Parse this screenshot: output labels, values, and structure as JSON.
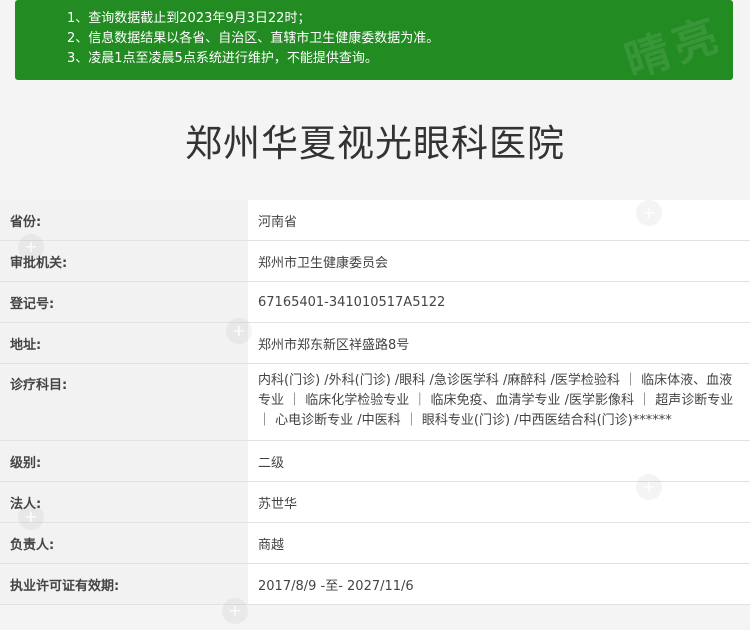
{
  "notice": {
    "lines": [
      "1、查询数据截止到2023年9月3日22时；",
      "2、信息数据结果以各省、自治区、直辖市卫生健康委数据为准。",
      "3、凌晨1点至凌晨5点系统进行维护，不能提供查询。"
    ],
    "watermark": "晴亮",
    "colors": {
      "background": "#228b22",
      "text": "#ffffff"
    }
  },
  "page_title": "郑州华夏视光眼科医院",
  "rows": [
    {
      "label": "省份:",
      "value": "河南省"
    },
    {
      "label": "审批机关:",
      "value": "郑州市卫生健康委员会"
    },
    {
      "label": "登记号:",
      "value": "67165401-341010517A5122"
    },
    {
      "label": "地址:",
      "value": "郑州市郑东新区祥盛路8号"
    },
    {
      "label": "诊疗科目:",
      "value": "内科(门诊) /外科(门诊) /眼科 /急诊医学科 /麻醉科 /医学检验科 ｜ 临床体液、血液专业 ｜ 临床化学检验专业 ｜ 临床免疫、血清学专业 /医学影像科 ｜ 超声诊断专业 ｜ 心电诊断专业 /中医科 ｜ 眼科专业(门诊) /中西医结合科(门诊)******"
    },
    {
      "label": "级别:",
      "value": "二级"
    },
    {
      "label": "法人:",
      "value": "苏世华"
    },
    {
      "label": "负责人:",
      "value": "商越"
    },
    {
      "label": "执业许可证有效期:",
      "value": "2017/8/9 -至- 2027/11/6"
    }
  ],
  "icons": {
    "watermark": "plus-circle-icon"
  }
}
